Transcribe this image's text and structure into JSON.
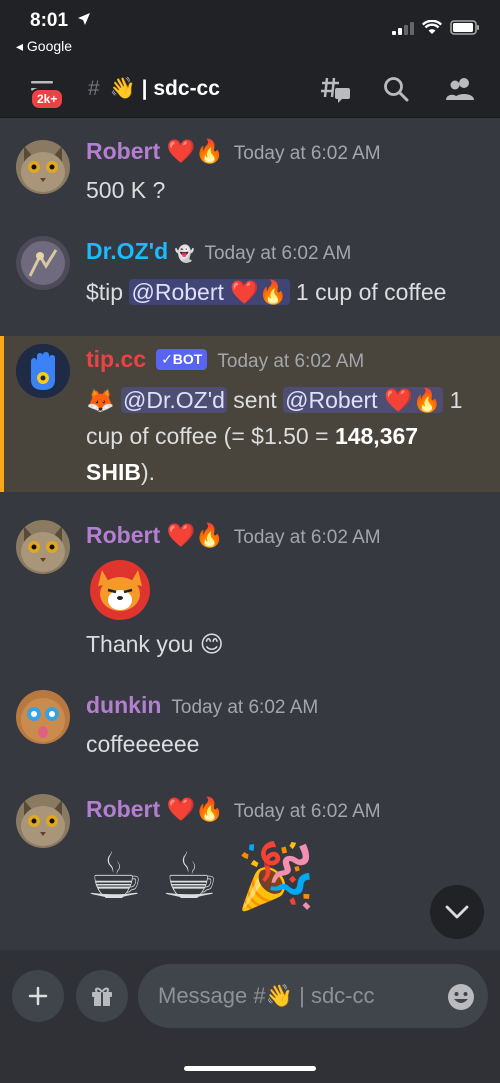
{
  "status": {
    "time": "8:01",
    "back_label": "◂ Google"
  },
  "header": {
    "badge": "2k+",
    "channel_name": "👋 | sdc-cc"
  },
  "messages": [
    {
      "author": "Robert",
      "author_badges": "❤️🔥",
      "author_color": "#b47fd1",
      "time": "Today at 6:02 AM",
      "text": "500 K ?"
    },
    {
      "author": "Dr.OZ'd",
      "author_badges": "👻",
      "author_color": "#1abcfe",
      "time": "Today at 6:02 AM",
      "text_prefix": "$tip ",
      "mention": "@Robert ❤️🔥",
      "text_suffix": " 1 cup of coffee"
    },
    {
      "author": "tip.cc",
      "bot_tag": "✓BOT",
      "author_color": "#ed4245",
      "time": "Today at 6:02 AM",
      "emoji": "🦊",
      "mention1": "@Dr.OZ'd",
      "mid_text": " sent ",
      "mention2": "@Robert ❤️🔥",
      "text_suffix": " 1 cup of coffee (= $1.50 = ",
      "bold": "148,367 SHIB",
      "end": ")."
    },
    {
      "author": "Robert",
      "author_badges": "❤️🔥",
      "author_color": "#b47fd1",
      "time": "Today at 6:02 AM",
      "sticker": "shiba-sticker",
      "text": "Thank you 😊"
    },
    {
      "author": "dunkin",
      "author_color": "#b47fd1",
      "time": "Today at 6:02 AM",
      "text": "coffeeeeee"
    },
    {
      "author": "Robert",
      "author_badges": "❤️🔥",
      "author_color": "#b47fd1",
      "time": "Today at 6:02 AM",
      "text": "☕ ☕ 🎉"
    }
  ],
  "composer": {
    "placeholder": "Message #👋 | sdc-cc"
  },
  "colors": {
    "background": "#36393f",
    "header": "#202225",
    "mention_bg": "#414675",
    "highlight_bg": "#49443c",
    "highlight_border": "#faa81a"
  }
}
